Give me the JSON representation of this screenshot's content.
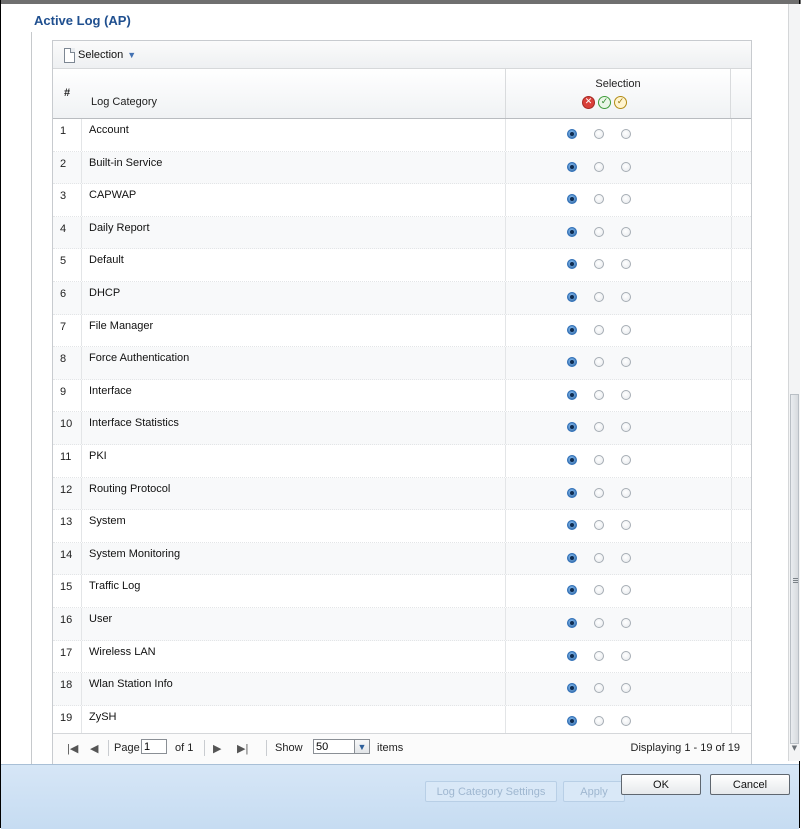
{
  "section": {
    "title": "Active Log (AP)"
  },
  "toolbar": {
    "selection_label": "Selection"
  },
  "grid": {
    "header": {
      "num": "#",
      "category": "Log Category",
      "selection": "Selection"
    },
    "header_icons": [
      {
        "name": "disable-all-icon",
        "glyph": "✕",
        "color": "#d9403a"
      },
      {
        "name": "enable-all-icon",
        "glyph": "✓",
        "color": "#2f8a2d"
      },
      {
        "name": "enable-all-alt-icon",
        "glyph": "✓",
        "color": "#b38c16"
      }
    ],
    "rows": [
      {
        "num": "1",
        "category": "Account",
        "selected": 0
      },
      {
        "num": "2",
        "category": "Built-in Service",
        "selected": 0
      },
      {
        "num": "3",
        "category": "CAPWAP",
        "selected": 0
      },
      {
        "num": "4",
        "category": "Daily Report",
        "selected": 0
      },
      {
        "num": "5",
        "category": "Default",
        "selected": 0
      },
      {
        "num": "6",
        "category": "DHCP",
        "selected": 0
      },
      {
        "num": "7",
        "category": "File Manager",
        "selected": 0
      },
      {
        "num": "8",
        "category": "Force Authentication",
        "selected": 0
      },
      {
        "num": "9",
        "category": "Interface",
        "selected": 0
      },
      {
        "num": "10",
        "category": "Interface Statistics",
        "selected": 0
      },
      {
        "num": "11",
        "category": "PKI",
        "selected": 0
      },
      {
        "num": "12",
        "category": "Routing Protocol",
        "selected": 0
      },
      {
        "num": "13",
        "category": "System",
        "selected": 0
      },
      {
        "num": "14",
        "category": "System Monitoring",
        "selected": 0
      },
      {
        "num": "15",
        "category": "Traffic Log",
        "selected": 0
      },
      {
        "num": "16",
        "category": "User",
        "selected": 0
      },
      {
        "num": "17",
        "category": "Wireless LAN",
        "selected": 0
      },
      {
        "num": "18",
        "category": "Wlan Station Info",
        "selected": 0
      },
      {
        "num": "19",
        "category": "ZySH",
        "selected": 0
      }
    ]
  },
  "pager": {
    "page_label": "Page",
    "page_value": "1",
    "of_label": "of 1",
    "show_label": "Show",
    "show_value": "50",
    "items_label": "items",
    "display_text": "Displaying 1 - 19 of 19"
  },
  "footer": {
    "log_category_settings": "Log Category Settings",
    "apply": "Apply",
    "ok": "OK",
    "cancel": "Cancel"
  },
  "colors": {
    "title": "#1f4f8f",
    "footer_bg": "#c6dcf2",
    "radio_checked": "#2b5f98"
  }
}
